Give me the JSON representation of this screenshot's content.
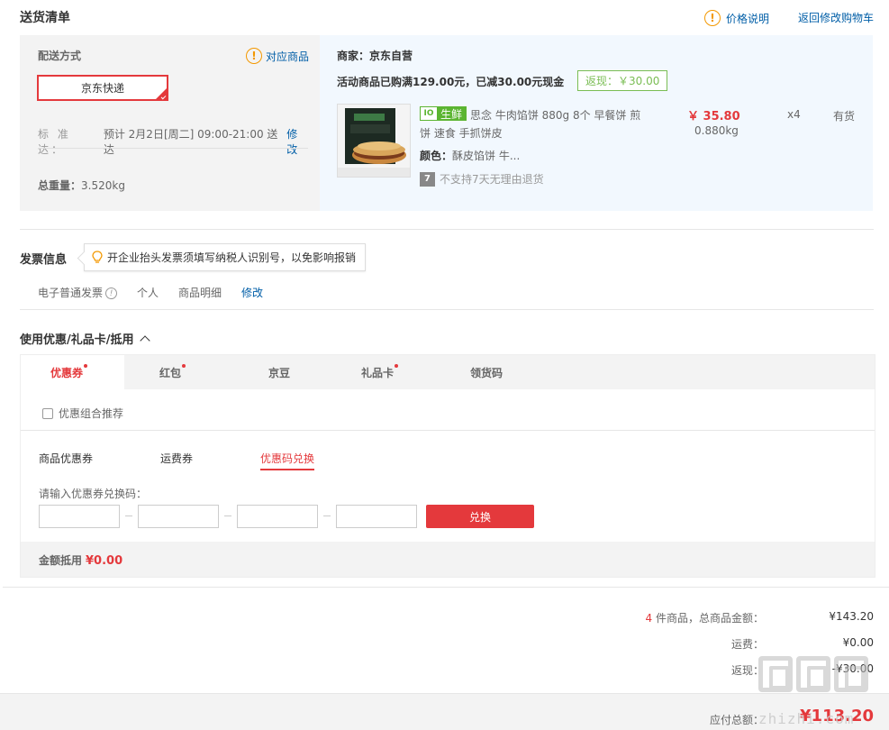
{
  "header": {
    "title": "送货清单",
    "price_note": "价格说明",
    "back_to_cart": "返回修改购物车"
  },
  "delivery": {
    "label": "配送方式",
    "matched_goods": "对应商品",
    "option": "京东快递",
    "standard_label": "标 准 达：",
    "standard_value": "预计 2月2日[周二] 09:00-21:00 送达",
    "edit": "修改",
    "weight_label": "总重量：",
    "weight_value": "3.520kg"
  },
  "goods": {
    "seller": "商家：京东自营",
    "promo": "活动商品已购满129.00元，已减30.00元现金",
    "cashback": "返现：￥30.00",
    "fresh_badge": "生鲜",
    "name": "思念 牛肉馅饼 880g 8个 早餐饼 煎饼 速食 手抓饼皮",
    "price": "￥ 35.80",
    "weight": "0.880kg",
    "qty": "x4",
    "stock": "有货",
    "color_label": "颜色：",
    "color_value": "酥皮馅饼 牛...",
    "return_icon": "7",
    "return_policy": "不支持7天无理由退货"
  },
  "invoice": {
    "title": "发票信息",
    "tip": "开企业抬头发票须填写纳税人识别号，以免影响报销",
    "type": "电子普通发票",
    "title_type": "个人",
    "content": "商品明细",
    "edit": "修改"
  },
  "coupons": {
    "title": "使用优惠/礼品卡/抵用",
    "tabs": [
      {
        "label": "优惠券"
      },
      {
        "label": "红包"
      },
      {
        "label": "京豆"
      },
      {
        "label": "礼品卡"
      },
      {
        "label": "领货码"
      }
    ],
    "combo": "优惠组合推荐",
    "subtabs": [
      "商品优惠券",
      "运费券",
      "优惠码兑换"
    ],
    "code_label": "请输入优惠券兑换码：",
    "redeem": "兑换",
    "deduct_label": "金额抵用",
    "deduct_value": "¥0.00"
  },
  "summary": {
    "count": "4",
    "count_label": " 件商品，总商品金额：",
    "total": "¥143.20",
    "shipping_label": "运费：",
    "shipping": "¥0.00",
    "cashback_label": "返现：",
    "cashback": "-¥30.00",
    "payable_label": "应付总额：",
    "payable": "¥113.20"
  },
  "watermark": {
    "text": "zhizhi.com"
  },
  "colors": {
    "accent": "#e4393c",
    "link": "#005ea7",
    "fresh_green": "#5bb531",
    "cashback_green": "#7abd54"
  }
}
